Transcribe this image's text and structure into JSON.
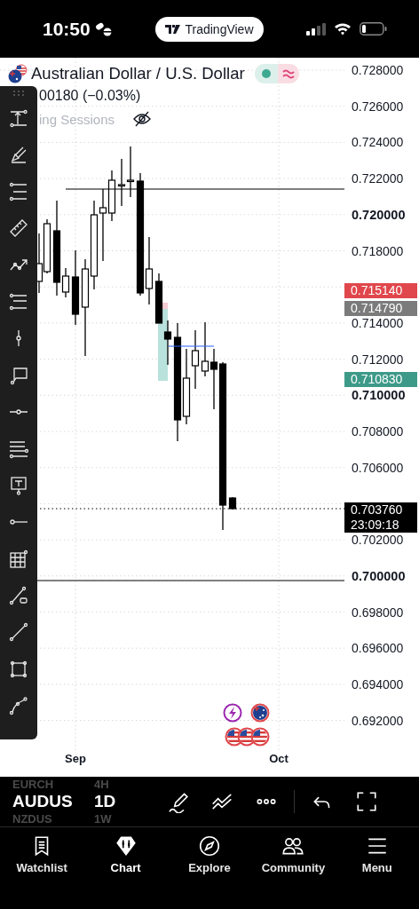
{
  "status_bar": {
    "time": "10:50",
    "app_pill": "TradingView"
  },
  "header": {
    "symbol_title": "Australian Dollar / U.S. Dollar",
    "market_open": true,
    "change": "00180 (−0.03%)",
    "sessions_label": "ing Sessions",
    "sessions_visible": false
  },
  "price_axis": [
    {
      "label": "0.728000",
      "bold": false
    },
    {
      "label": "0.726000",
      "bold": false
    },
    {
      "label": "0.724000",
      "bold": false
    },
    {
      "label": "0.722000",
      "bold": false
    },
    {
      "label": "0.720000",
      "bold": true
    },
    {
      "label": "0.718000",
      "bold": false
    },
    {
      "label": "0.714000",
      "bold": false
    },
    {
      "label": "0.712000",
      "bold": false
    },
    {
      "label": "0.710000",
      "bold": true
    },
    {
      "label": "0.708000",
      "bold": false
    },
    {
      "label": "0.706000",
      "bold": false
    },
    {
      "label": "0.702000",
      "bold": false
    },
    {
      "label": "0.700000",
      "bold": true
    },
    {
      "label": "0.698000",
      "bold": false
    },
    {
      "label": "0.696000",
      "bold": false
    },
    {
      "label": "0.694000",
      "bold": false
    },
    {
      "label": "0.692000",
      "bold": false
    }
  ],
  "price_markers": [
    {
      "price": "0.715140",
      "color": "#e0474c"
    },
    {
      "price": "0.714790",
      "color": "#7b7b7b"
    },
    {
      "price": "0.710830",
      "color": "#3d9a88"
    },
    {
      "price": "0.703760",
      "countdown": "23:09:18",
      "color": "#000000"
    }
  ],
  "time_axis": [
    "Sep",
    "Oct"
  ],
  "symbol_picker": [
    {
      "symbol": "EURCH",
      "interval": "4H",
      "selected": false
    },
    {
      "symbol": "AUDUS",
      "interval": "1D",
      "selected": true
    },
    {
      "symbol": "NZDUS",
      "interval": "1W",
      "selected": false
    }
  ],
  "tabs": [
    {
      "label": "Watchlist",
      "selected": false
    },
    {
      "label": "Chart",
      "selected": true
    },
    {
      "label": "Explore",
      "selected": false
    },
    {
      "label": "Community",
      "selected": false
    },
    {
      "label": "Menu",
      "selected": false
    }
  ]
}
